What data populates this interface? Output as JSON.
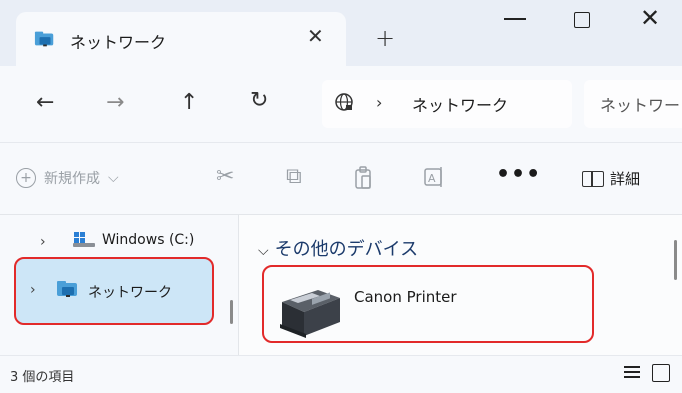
{
  "tab": {
    "title": "ネットワーク",
    "close_glyph": "✕",
    "new_tab_glyph": "+",
    "icon": "network-folder-icon"
  },
  "window_controls": {
    "minimize": "minimize-icon",
    "maximize": "maximize-icon",
    "close_glyph": "✕"
  },
  "nav": {
    "back": "←",
    "forward": "→",
    "up": "↑",
    "refresh": "↻"
  },
  "address": {
    "separator": "›",
    "crumb": "ネットワーク",
    "icon": "globe-icon"
  },
  "search": {
    "text": "ネットワー"
  },
  "toolbar": {
    "new_label": "新規作成",
    "new_chevron": "⌵",
    "new_plus": "+",
    "cut_glyph": "✂",
    "copy_glyph": "⧉",
    "paste_glyph": "📋",
    "rename_glyph": "A",
    "more_glyph": "•••",
    "details_label": "詳細"
  },
  "nav_pane": {
    "items": [
      {
        "label": "Windows (C:)",
        "chevron": "›",
        "icon": "drive-icon"
      },
      {
        "label": "ネットワーク",
        "chevron": "›",
        "icon": "network-folder-icon",
        "selected": true
      }
    ]
  },
  "content": {
    "group_chevron": "⌵",
    "group_title": "その他のデバイス",
    "items": [
      {
        "label": "Canon Printer",
        "icon": "printer-icon"
      }
    ]
  },
  "status": {
    "item_count": "3 個の項目"
  },
  "colors": {
    "highlight_outline": "#e22a2a",
    "selection": "#cde6f7"
  }
}
